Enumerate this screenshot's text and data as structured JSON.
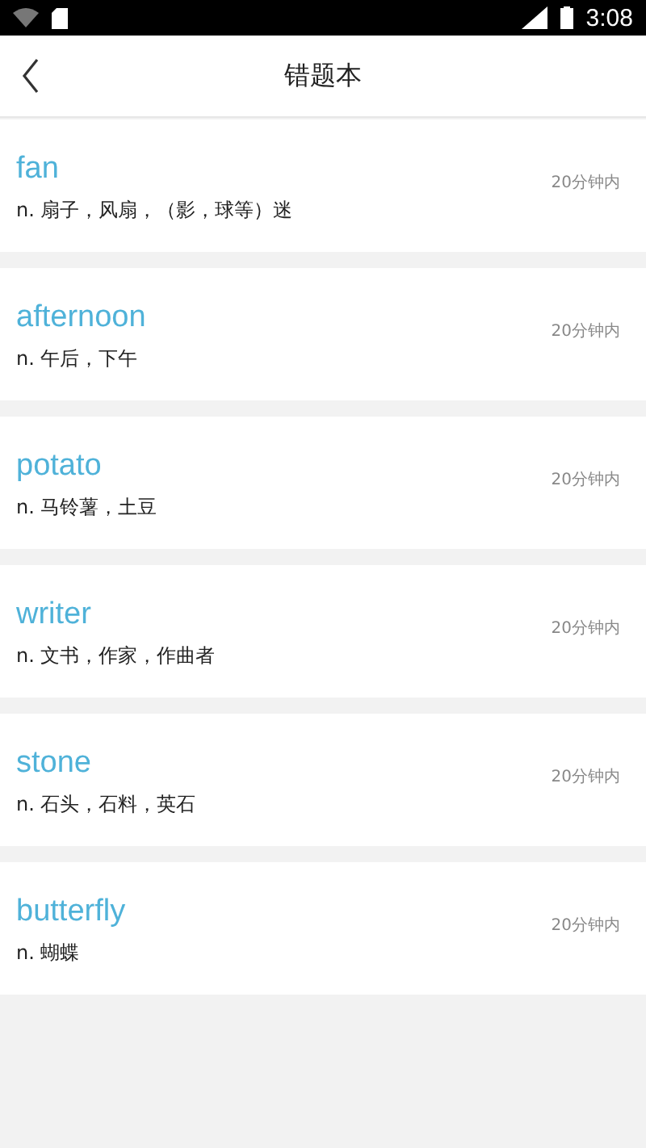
{
  "status_bar": {
    "time": "3:08"
  },
  "header": {
    "title": "错题本"
  },
  "words": [
    {
      "word": "fan",
      "meaning": "n. 扇子，风扇，（影，球等）迷",
      "time": "20分钟内"
    },
    {
      "word": "afternoon",
      "meaning": "n. 午后，下午",
      "time": "20分钟内"
    },
    {
      "word": "potato",
      "meaning": "n. 马铃薯，土豆",
      "time": "20分钟内"
    },
    {
      "word": "writer",
      "meaning": "n. 文书，作家，作曲者",
      "time": "20分钟内"
    },
    {
      "word": "stone",
      "meaning": "n. 石头，石料，英石",
      "time": "20分钟内"
    },
    {
      "word": "butterfly",
      "meaning": "n. 蝴蝶",
      "time": "20分钟内"
    }
  ]
}
